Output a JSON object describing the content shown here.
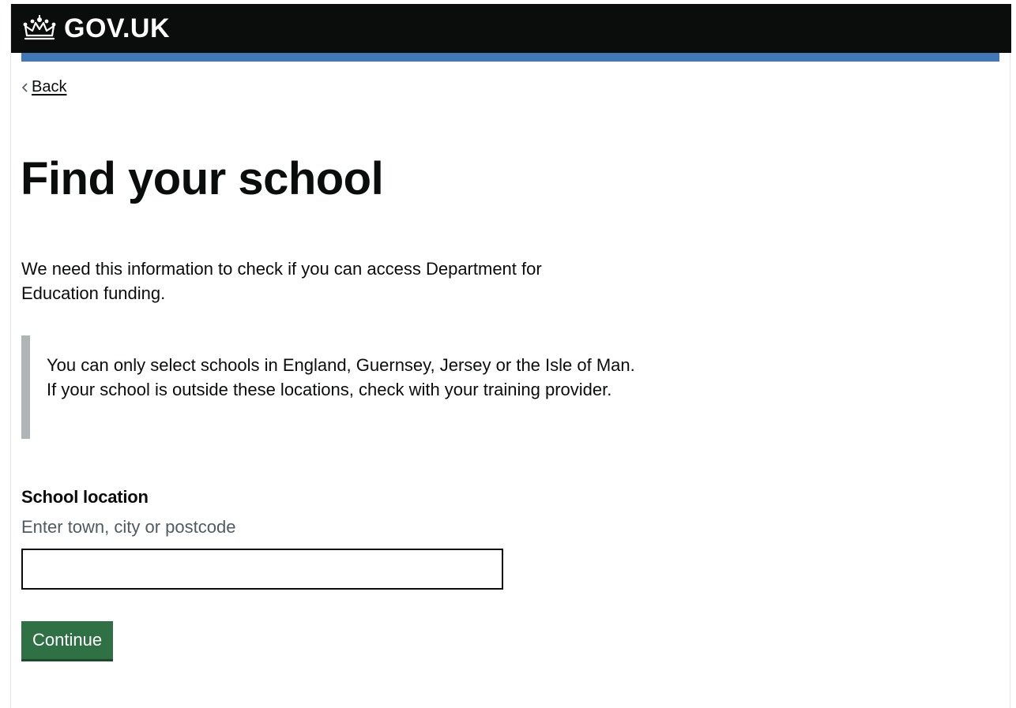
{
  "header": {
    "logo_text": "GOV.UK",
    "logo_icon": "crown-icon",
    "background_color": "#0b0c0c",
    "stripe_color": "#4179b8"
  },
  "back_link": {
    "label": "Back",
    "icon": "chevron-left-icon"
  },
  "page": {
    "title": "Find your school",
    "lede": "We need this information to check if you can access Department for Education funding.",
    "inset_text": "You can only select schools in England, Guernsey, Jersey or the Isle of Man. If your school is outside these locations, check with your training provider."
  },
  "form": {
    "label": "School location",
    "hint": "Enter town, city or postcode",
    "input_value": "",
    "continue_label": "Continue",
    "button_color": "#2f7145"
  }
}
